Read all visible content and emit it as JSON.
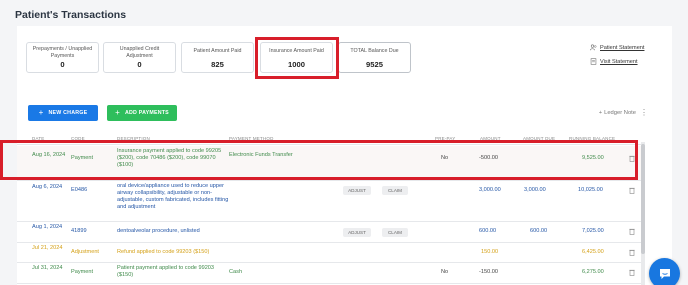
{
  "page": {
    "title": "Patient's Transactions"
  },
  "summary": [
    {
      "label": "Prepayments / Unapplied Payments",
      "value": "0"
    },
    {
      "label": "Unapplied Credit Adjustment",
      "value": "0"
    },
    {
      "label": "Patient Amount Paid",
      "value": "825"
    },
    {
      "label": "Insurance Amount Paid",
      "value": "1000"
    },
    {
      "label": "TOTAL Balance Due",
      "value": "9525"
    }
  ],
  "links": {
    "patient_statement": "Patient Statement",
    "visit_statement": "Visit Statement"
  },
  "actions": {
    "new_charge": "NEW CHARGE",
    "add_payments": "ADD PAYMENTS",
    "ledger_note": "Ledger Note"
  },
  "table": {
    "headers": {
      "date": "DATE",
      "code": "CODE",
      "description": "DESCRIPTION",
      "payment_method": "PAYMENT METHOD",
      "pre_pay": "PRE-PAY",
      "amount": "AMOUNT",
      "amount_due": "AMOUNT DUE",
      "running_balance": "RUNNING BALANCE"
    },
    "adjust_label": "ADJUST",
    "claim_label": "CLAIM",
    "rows": [
      {
        "date": "Aug 16, 2024",
        "code": "Payment",
        "description": "Insurance payment applied to code 99205 ($200), code 70486 ($200), code 99070 ($100)",
        "payment_method": "Electronic Funds Transfer",
        "pre_pay": "No",
        "amount": "-500.00",
        "amount_due": "",
        "running_balance": "9,525.00"
      },
      {
        "date": "Aug 6, 2024",
        "code": "E0486",
        "description": "oral device/appliance used to reduce upper airway collapsibility, adjustable or non-adjustable, custom fabricated, includes fitting and adjustment",
        "payment_method": "",
        "pre_pay": "",
        "amount": "3,000.00",
        "amount_due": "3,000.00",
        "running_balance": "10,025.00"
      },
      {
        "date": "Aug 1, 2024",
        "code": "41899",
        "description": "dentoalveolar procedure, unlisted",
        "payment_method": "",
        "pre_pay": "",
        "amount": "600.00",
        "amount_due": "600.00",
        "running_balance": "7,025.00"
      },
      {
        "date": "Jul 21, 2024",
        "code": "Adjustment",
        "description": "Refund applied to code 99203 ($150)",
        "payment_method": "",
        "pre_pay": "",
        "amount": "150.00",
        "amount_due": "",
        "running_balance": "6,425.00"
      },
      {
        "date": "Jul 31, 2024",
        "code": "Payment",
        "description": "Patient payment applied to code 99203 ($150)",
        "payment_method": "Cash",
        "pre_pay": "No",
        "amount": "-150.00",
        "amount_due": "",
        "running_balance": "6,275.00"
      }
    ]
  },
  "colors": {
    "highlight_red": "#d81e2a",
    "payment_green": "#3f8a4a",
    "charge_blue": "#2456a6",
    "adjustment_gold": "#d4a017",
    "primary_blue": "#1a79e6",
    "success_green": "#2ebe5c"
  },
  "icons": {
    "patient_statement": "people-icon",
    "visit_statement": "document-icon",
    "ledger": "plus-icon",
    "more": "kebab-icon",
    "delete": "trash-icon",
    "chat": "chat-icon"
  }
}
